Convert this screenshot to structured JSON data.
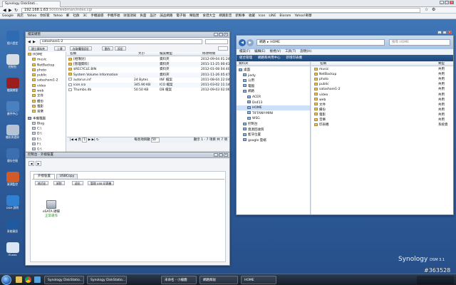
{
  "browser": {
    "tab_title": "Synology DiskStati...",
    "url_host": "192.168.1.63",
    "url_path": ":5000/webman/index.cgi",
    "bookmarks": [
      "Google",
      "商店",
      "Yahoo",
      "你好家",
      "Yahoo",
      "郵",
      "社群",
      "3C",
      "手機論壇",
      "手機序號",
      "財富須知",
      "負面",
      "設計",
      "誠品網路",
      "電子報",
      "樂點匯",
      "食谱大全",
      "網路影音",
      "新鮮事",
      "收藏",
      "Icon",
      "LINE",
      "Bioram",
      "Yahoo!奇摩"
    ]
  },
  "desktop": {
    "icons": [
      {
        "label": "個人設定",
        "icon": "synology-manager-icon"
      },
      {
        "label": "控制台",
        "icon": "control-panel-icon"
      },
      {
        "label": "檔案總管",
        "icon": "file-station-icon"
      },
      {
        "label": "套件中心",
        "icon": "package-center-icon"
      },
      {
        "label": "備份與還原",
        "icon": "backup-icon"
      },
      {
        "label": "儲存空間",
        "icon": "storage-icon"
      },
      {
        "label": "資源監控",
        "icon": "resource-monitor-icon"
      },
      {
        "label": "DSM 說明",
        "icon": "help-icon"
      },
      {
        "label": "系統資訊",
        "icon": "system-info-icon"
      },
      {
        "label": "iTunes",
        "icon": "itunes-icon"
      }
    ],
    "brand": "Synology",
    "brand_version": "DSM 3.1",
    "watermark": "#363528"
  },
  "file_station": {
    "title": "檔案總管",
    "path": "satashare1-2",
    "toolbar": [
      "建立資料夾",
      "上傳",
      "存取權限設定",
      "動作",
      "設定"
    ],
    "columns": [
      "名稱",
      "大小",
      "檔案類型",
      "修改時間"
    ],
    "tree_nas": [
      "HOME",
      "music",
      "NetBackup",
      "photo",
      "public",
      "satashare1-2",
      "video",
      "web",
      "文件",
      "備份",
      "電影",
      "音樂"
    ],
    "tree_local_root": "本機電腦",
    "tree_local": [
      "Blog",
      "C:\\",
      "D:\\",
      "E:\\",
      "F:\\",
      "G:\\",
      "H:\\",
      "I:\\"
    ],
    "files": [
      {
        "name": "[相簿封]",
        "size": "",
        "type": "資料夾",
        "modified": "2012-09-04 01:24:01"
      },
      {
        "name": "[管理資料]",
        "size": "",
        "type": "資料夾",
        "modified": "2011-11-25 00:41:39"
      },
      {
        "name": "$RECYCLE.BIN",
        "size": "",
        "type": "資料夾",
        "modified": "2012-01-08 04:40:01"
      },
      {
        "name": "System Volume Information",
        "size": "",
        "type": "資料夾",
        "modified": "2011-11-26 05:47:16"
      },
      {
        "name": "autorun.inf",
        "size": "24 Bytes",
        "type": "INF 檔案",
        "modified": "2011-08-04 22:04:10"
      },
      {
        "name": "icon.ico",
        "size": "345.90 KB",
        "type": "ICO 檔案",
        "modified": "2011-03-02 11:14:07"
      },
      {
        "name": "Thumbs.db",
        "size": "50.50 KB",
        "type": "DB 檔案",
        "modified": "2012-09-03 02:06:43"
      }
    ],
    "pager_page": "1",
    "pager_per_page": "每頁項目數",
    "pager_per_page_value": "50",
    "pager_summary": "顯示 1 - 7 項目 共 7 項",
    "status": "已使用空間: 2019.88 GB / 總容量: 2030.00 GB"
  },
  "external_devices": {
    "title": "控制台 - 外接裝置",
    "tabs": [
      "外接裝置",
      "USBCopy"
    ],
    "toolbar": [
      "格式化",
      "卸除",
      "退出",
      "管理 USB 印表機"
    ],
    "device_name": "eSATA 硬碟",
    "device_status": "正常運作"
  },
  "explorer": {
    "breadcrumb": [
      "網路",
      "HOME"
    ],
    "search_placeholder": "搜尋 HOME",
    "menu": [
      "檔案(F)",
      "編輯(E)",
      "檢視(V)",
      "工具(T)",
      "說明(H)"
    ],
    "commands": [
      "組合管理",
      "網路和共用中心",
      "新增印表機"
    ],
    "left_header": "資料夾",
    "nav": [
      {
        "label": "桌面",
        "level": 0
      },
      {
        "label": "jiedy",
        "level": 1
      },
      {
        "label": "公用",
        "level": 1
      },
      {
        "label": "電腦",
        "level": 1
      },
      {
        "label": "網路",
        "level": 1
      },
      {
        "label": "ACER",
        "level": 2
      },
      {
        "label": "Ds413",
        "level": 2
      },
      {
        "label": "HOME",
        "level": 2
      },
      {
        "label": "TIFFANY-MINI",
        "level": 2
      },
      {
        "label": "WSG",
        "level": 2
      },
      {
        "label": "控制台",
        "level": 1
      },
      {
        "label": "資源回收筒",
        "level": 1
      },
      {
        "label": "藍牙位置",
        "level": 1
      },
      {
        "label": "google 雲端",
        "level": 1
      }
    ],
    "columns": [
      "名稱",
      "類型"
    ],
    "items": [
      {
        "name": "music",
        "type": "共用"
      },
      {
        "name": "NetBackup",
        "type": "共用"
      },
      {
        "name": "photo",
        "type": "共用"
      },
      {
        "name": "public",
        "type": "共用"
      },
      {
        "name": "satashare1-2",
        "type": "共用"
      },
      {
        "name": "video",
        "type": "共用"
      },
      {
        "name": "web",
        "type": "共用"
      },
      {
        "name": "文件",
        "type": "共用"
      },
      {
        "name": "備份",
        "type": "共用"
      },
      {
        "name": "電影",
        "type": "共用"
      },
      {
        "name": "音樂",
        "type": "共用"
      },
      {
        "name": "印表機",
        "type": "系統資"
      }
    ]
  },
  "taskbar": {
    "items": [
      "Synology DiskStatio...",
      "Synology DiskStatio...",
      "未命名 - 小繪圖",
      "網路鄰居",
      "HOME"
    ]
  },
  "colors": {
    "accent": "#3f76b6",
    "title": "#c4cfdc",
    "select": "#cde0f7"
  }
}
